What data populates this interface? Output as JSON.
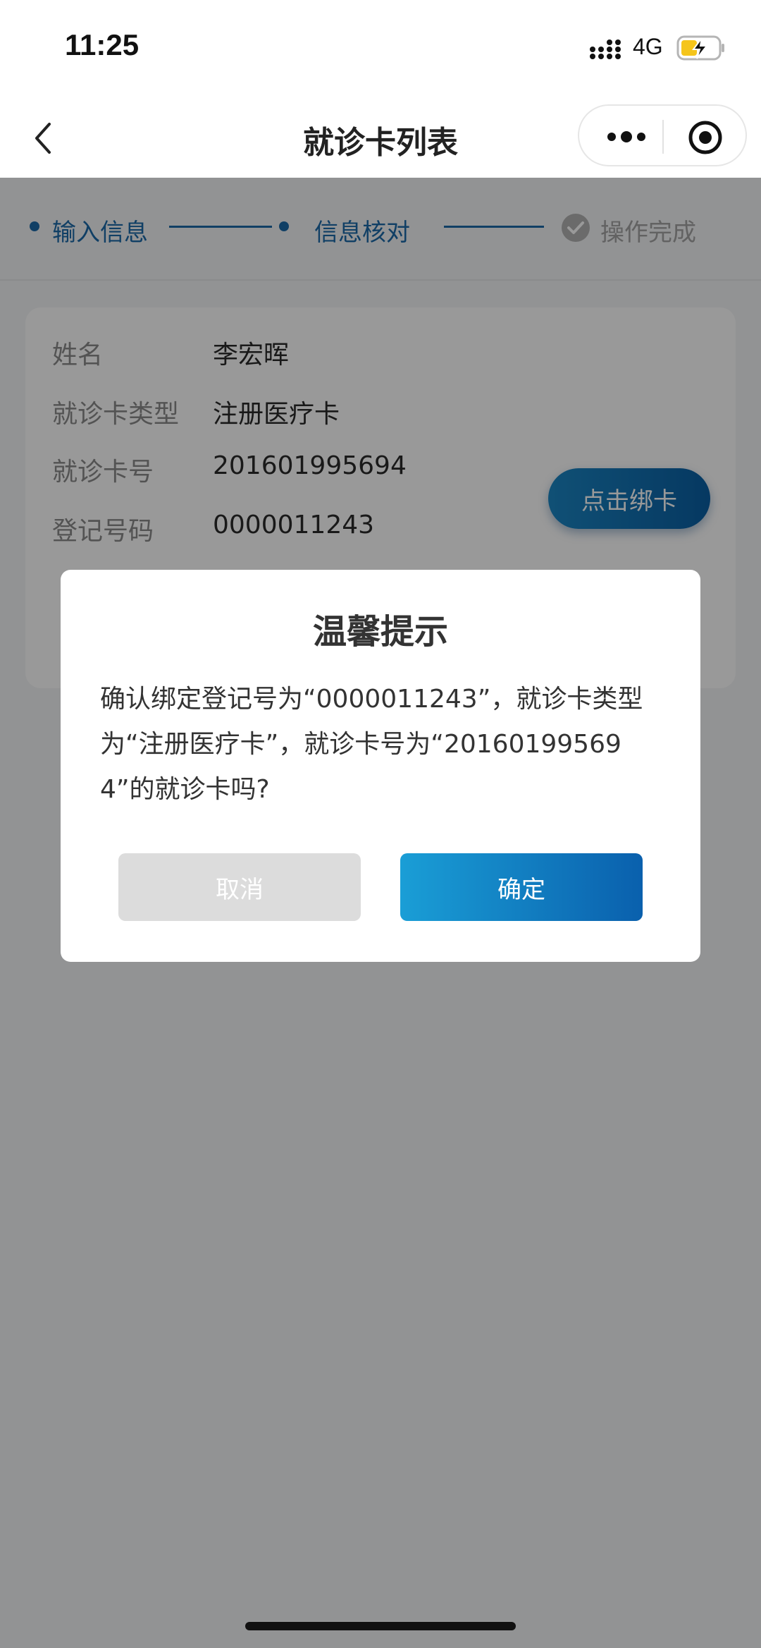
{
  "status_bar": {
    "time": "11:25",
    "network": "4G"
  },
  "nav": {
    "title": "就诊卡列表"
  },
  "steps": [
    {
      "label": "输入信息"
    },
    {
      "label": "信息核对"
    },
    {
      "label": "操作完成"
    }
  ],
  "card": {
    "rows": [
      {
        "label": "姓名",
        "value": "李宏晖"
      },
      {
        "label": "就诊卡类型",
        "value": "注册医疗卡"
      },
      {
        "label": "就诊卡号",
        "value": "201601995694"
      },
      {
        "label": "登记号码",
        "value": "0000011243"
      }
    ],
    "bind_button": "点击绑卡"
  },
  "dialog": {
    "title": "温馨提示",
    "message": "确认绑定登记号为“0000011243”，就诊卡类型为“注册医疗卡”，就诊卡号为“201601995694”的就诊卡吗?",
    "cancel_label": "取消",
    "confirm_label": "确定"
  },
  "colors": {
    "accent": "#1c69a8",
    "overlay": "#000000",
    "battery_fill": "#f5c51b"
  }
}
